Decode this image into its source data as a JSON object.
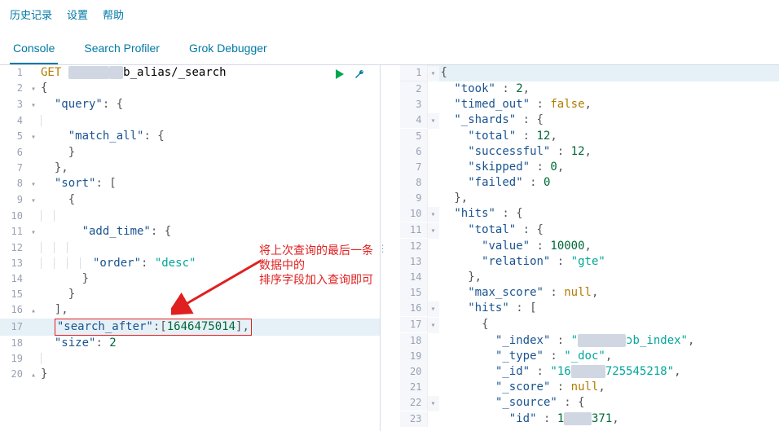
{
  "menu": {
    "history": "历史记录",
    "settings": "设置",
    "help": "帮助"
  },
  "tabs": {
    "console": "Console",
    "profiler": "Search Profiler",
    "grok": "Grok Debugger"
  },
  "annotation": {
    "line1": "将上次查询的最后一条数据中的",
    "line2": "排序字段加入查询即可"
  },
  "request": {
    "method": "GET",
    "endpoint_suffix": "b_alias/_search",
    "lines": [
      {
        "n": 1,
        "fold": "",
        "hl": false
      },
      {
        "n": 2,
        "fold": "▾",
        "hl": false,
        "raw": "{"
      },
      {
        "n": 3,
        "fold": "▾",
        "hl": false,
        "key": "query",
        "after": ": {",
        "indent": 1
      },
      {
        "n": 4,
        "fold": "",
        "hl": false,
        "raw": "",
        "indent": 1
      },
      {
        "n": 5,
        "fold": "▾",
        "hl": false,
        "key": "match_all",
        "after": ": {",
        "indent": 2
      },
      {
        "n": 6,
        "fold": "",
        "hl": false,
        "raw": "}",
        "indent": 2
      },
      {
        "n": 7,
        "fold": "",
        "hl": false,
        "raw": "},",
        "indent": 1
      },
      {
        "n": 8,
        "fold": "▾",
        "hl": false,
        "key": "sort",
        "after": ": [",
        "indent": 1
      },
      {
        "n": 9,
        "fold": "▾",
        "hl": false,
        "raw": "{",
        "indent": 2
      },
      {
        "n": 10,
        "fold": "",
        "hl": false,
        "raw": "",
        "indent": 2
      },
      {
        "n": 11,
        "fold": "▾",
        "hl": false,
        "key": "add_time",
        "after": ": {",
        "indent": 3
      },
      {
        "n": 12,
        "fold": "",
        "hl": false,
        "raw": "",
        "indent": 3
      },
      {
        "n": 13,
        "fold": "",
        "hl": false,
        "key": "order",
        "val_str": "desc",
        "indent": 4
      },
      {
        "n": 14,
        "fold": "",
        "hl": false,
        "raw": "}",
        "indent": 3
      },
      {
        "n": 15,
        "fold": "",
        "hl": false,
        "raw": "}",
        "indent": 2
      },
      {
        "n": 16,
        "fold": "▴",
        "hl": false,
        "raw": "],",
        "indent": 1
      },
      {
        "n": 17,
        "fold": "",
        "hl": true,
        "special": "search_after"
      },
      {
        "n": 18,
        "fold": "",
        "hl": false,
        "key": "size",
        "val_num": 2,
        "indent": 1
      },
      {
        "n": 19,
        "fold": "",
        "hl": false,
        "raw": "",
        "indent": 1
      },
      {
        "n": 20,
        "fold": "▴",
        "hl": false,
        "raw": "}"
      }
    ],
    "search_after_key": "search_after",
    "search_after_val": "1646475014"
  },
  "response": {
    "lines": [
      {
        "n": 1,
        "fold": "▾",
        "hl": true,
        "raw": "{"
      },
      {
        "n": 2,
        "fold": "",
        "key": "took",
        "val_num": 2,
        "after": ",",
        "indent": 1
      },
      {
        "n": 3,
        "fold": "",
        "key": "timed_out",
        "val_bool": "false",
        "after": ",",
        "indent": 1
      },
      {
        "n": 4,
        "fold": "▾",
        "key": "_shards",
        "after": " : {",
        "indent": 1
      },
      {
        "n": 5,
        "fold": "",
        "key": "total",
        "val_num": 12,
        "after": ",",
        "indent": 2
      },
      {
        "n": 6,
        "fold": "",
        "key": "successful",
        "val_num": 12,
        "after": ",",
        "indent": 2
      },
      {
        "n": 7,
        "fold": "",
        "key": "skipped",
        "val_num": 0,
        "after": ",",
        "indent": 2
      },
      {
        "n": 8,
        "fold": "",
        "key": "failed",
        "val_num": 0,
        "indent": 2
      },
      {
        "n": 9,
        "fold": "",
        "raw": "},",
        "indent": 1
      },
      {
        "n": 10,
        "fold": "▾",
        "key": "hits",
        "after": " : {",
        "indent": 1
      },
      {
        "n": 11,
        "fold": "▾",
        "key": "total",
        "after": " : {",
        "indent": 2
      },
      {
        "n": 12,
        "fold": "",
        "key": "value",
        "val_num": 10000,
        "after": ",",
        "indent": 3
      },
      {
        "n": 13,
        "fold": "",
        "key": "relation",
        "val_str": "gte",
        "indent": 3
      },
      {
        "n": 14,
        "fold": "",
        "raw": "},",
        "indent": 2
      },
      {
        "n": 15,
        "fold": "",
        "key": "max_score",
        "val_null": true,
        "after": ",",
        "indent": 2
      },
      {
        "n": 16,
        "fold": "▾",
        "key": "hits",
        "after": " : [",
        "indent": 2
      },
      {
        "n": 17,
        "fold": "▾",
        "raw": "{",
        "indent": 3
      },
      {
        "n": 18,
        "fold": "",
        "key": "_index",
        "val_obscured_suffix": "ɔb_index",
        "after": ",",
        "indent": 4
      },
      {
        "n": 19,
        "fold": "",
        "key": "_type",
        "val_str": "_doc",
        "after": ",",
        "indent": 4
      },
      {
        "n": 20,
        "fold": "",
        "key": "_id",
        "id_prefix": "16",
        "id_suffix": "725545218",
        "after": ",",
        "indent": 4
      },
      {
        "n": 21,
        "fold": "",
        "key": "_score",
        "val_null": true,
        "after": ",",
        "indent": 4
      },
      {
        "n": 22,
        "fold": "▾",
        "key": "_source",
        "after": " : {",
        "indent": 4
      },
      {
        "n": 23,
        "fold": "",
        "key": "id",
        "id2_prefix": "1",
        "id2_suffix": "371",
        "after": ",",
        "indent": 5
      }
    ]
  }
}
